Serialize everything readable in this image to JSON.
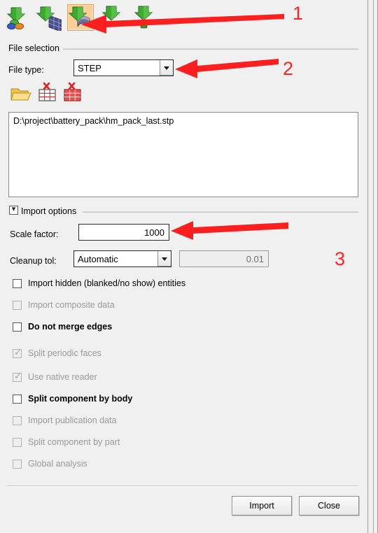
{
  "toolbar": {
    "buttons": [
      {
        "name": "import-geometry-icon",
        "tip": "Import Geometry",
        "selected": false
      },
      {
        "name": "import-mesh-icon",
        "tip": "Import Mesh",
        "selected": false
      },
      {
        "name": "import-solver-deck-icon",
        "tip": "Import Solver Deck",
        "selected": true
      },
      {
        "name": "import-connectors-icon",
        "tip": "Import Connectors",
        "selected": false
      },
      {
        "name": "import-other-icon",
        "tip": "Import Other",
        "selected": false
      }
    ]
  },
  "file_selection": {
    "group_title": "File selection",
    "file_type_label": "File type:",
    "file_type_value": "STEP",
    "file_type_options": [
      "STEP"
    ],
    "icons": [
      {
        "name": "open-folder-icon",
        "tip": "Browse files"
      },
      {
        "name": "clear-table-icon",
        "tip": "Remove selected file"
      },
      {
        "name": "clear-all-table-icon",
        "tip": "Remove all files"
      }
    ],
    "file_path": "D:\\project\\battery_pack\\hm_pack_last.stp"
  },
  "import_options": {
    "group_title": "Import options",
    "group_enabled": true,
    "scale_factor_label": "Scale factor:",
    "scale_factor_value": "1000",
    "cleanup_tol_label": "Cleanup tol:",
    "cleanup_tol_value": "Automatic",
    "cleanup_tol_options": [
      "Automatic"
    ],
    "cleanup_tol_number": "0.01",
    "checkboxes": [
      {
        "label": "Import hidden (blanked/no show) entities",
        "checked": false,
        "enabled": true
      },
      {
        "label": "Import composite data",
        "checked": false,
        "enabled": false
      },
      {
        "label": "Do not merge edges",
        "checked": false,
        "enabled": true
      },
      {
        "label": "Split periodic faces",
        "checked": true,
        "enabled": false
      },
      {
        "label": "Use native reader",
        "checked": true,
        "enabled": false
      },
      {
        "label": "Split component by body",
        "checked": false,
        "enabled": true
      },
      {
        "label": "Import publication data",
        "checked": false,
        "enabled": false
      },
      {
        "label": "Split component by part",
        "checked": false,
        "enabled": false
      },
      {
        "label": "Global analysis",
        "checked": false,
        "enabled": false
      }
    ]
  },
  "footer": {
    "import_label": "Import",
    "close_label": "Close"
  },
  "annotations": {
    "color": "#ff2424",
    "markers": [
      {
        "label": "1",
        "target": "toolbar-import-solver-deck-button"
      },
      {
        "label": "2",
        "target": "file-type-combo"
      },
      {
        "label": "3",
        "target": "scale-factor-field"
      }
    ]
  }
}
